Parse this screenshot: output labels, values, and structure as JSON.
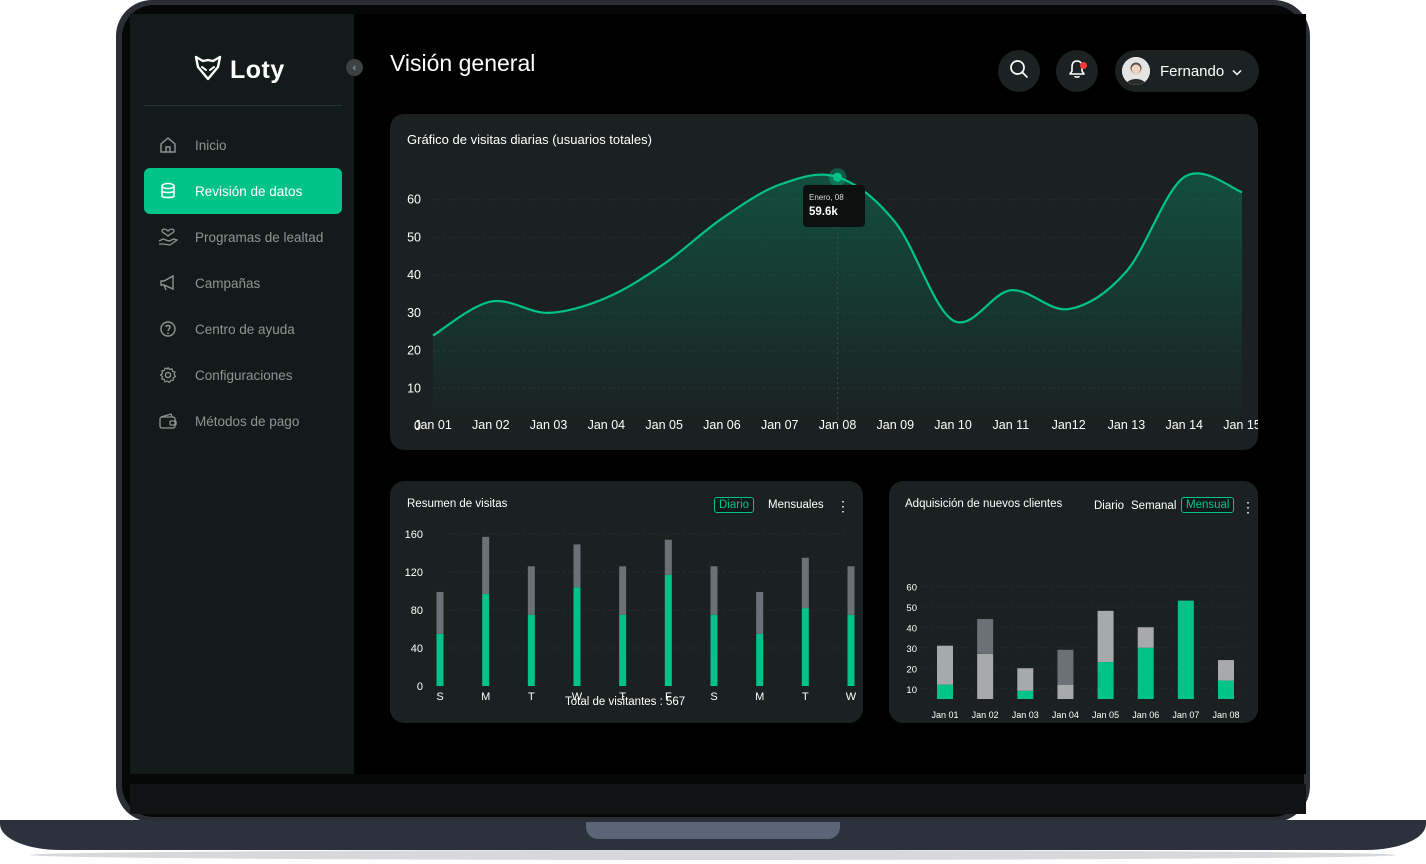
{
  "app": {
    "name": "Loty"
  },
  "sidebar": {
    "items": [
      {
        "label": "Inicio",
        "icon": "home-icon",
        "active": false
      },
      {
        "label": "Revisión de datos",
        "icon": "database-icon",
        "active": true
      },
      {
        "label": "Programas de lealtad",
        "icon": "hand-heart-icon",
        "active": false
      },
      {
        "label": "Campañas",
        "icon": "megaphone-icon",
        "active": false
      },
      {
        "label": "Centro de ayuda",
        "icon": "help-circle-icon",
        "active": false
      },
      {
        "label": "Configuraciones",
        "icon": "gear-icon",
        "active": false
      },
      {
        "label": "Métodos de pago",
        "icon": "wallet-icon",
        "active": false
      }
    ]
  },
  "header": {
    "title": "Visión general",
    "user": {
      "name": "Fernando"
    }
  },
  "colors": {
    "accent": "#00c389",
    "gray_bar": "#6b7176",
    "light_gray_bar": "#a7a9ab",
    "card": "#1a2120",
    "sidebar": "#131b1a"
  },
  "line_card": {
    "title": "Gráfico de visitas diarias (usuarios totales)",
    "tooltip": {
      "label": "Enero, 08",
      "value": "59.6k"
    }
  },
  "visits_card": {
    "title": "Resumen de visitas",
    "tabs": [
      "Diario",
      "Mensuales"
    ],
    "active_tab": "Diario",
    "total_label": "Total de visitantes : 567"
  },
  "acq_card": {
    "title": "Adquisición de nuevos clientes",
    "tabs": [
      "Diario",
      "Semanal",
      "Mensual"
    ],
    "active_tab": "Mensual"
  },
  "chart_data": [
    {
      "type": "area",
      "title": "Gráfico de visitas diarias (usuarios totales)",
      "categories": [
        "Jan 01",
        "Jan 02",
        "Jan 03",
        "Jan 04",
        "Jan 05",
        "Jan 06",
        "Jan 07",
        "Jan 08",
        "Jan 09",
        "Jan 10",
        "Jan 11",
        "Jan12",
        "Jan 13",
        "Jan 14",
        "Jan 15"
      ],
      "y_ticks": [
        0,
        10,
        20,
        30,
        40,
        50,
        60
      ],
      "ylim": [
        0,
        70
      ],
      "series": [
        {
          "x": [
            0,
            1,
            2,
            3,
            4,
            5,
            6,
            7,
            8,
            9,
            10,
            11,
            12,
            13,
            14
          ],
          "values": [
            24,
            33,
            30,
            34,
            43,
            55,
            64,
            66,
            54,
            28,
            36,
            31,
            41,
            66,
            62
          ]
        }
      ],
      "highlight": {
        "category": "Jan 08",
        "value": 66
      },
      "grid": true
    },
    {
      "type": "bar",
      "title": "Resumen de visitas",
      "stacked": true,
      "categories": [
        "S",
        "M",
        "T",
        "W",
        "T",
        "F",
        "S",
        "M",
        "T",
        "W"
      ],
      "y_ticks": [
        0,
        40,
        80,
        120,
        160
      ],
      "ylim": [
        0,
        160
      ],
      "series": [
        {
          "color": "#00c389",
          "values": [
            55,
            97,
            75,
            104,
            75,
            117,
            75,
            55,
            82,
            75
          ]
        },
        {
          "color": "#6b7176",
          "values": [
            44,
            60,
            51,
            45,
            51,
            37,
            51,
            44,
            53,
            51
          ]
        }
      ]
    },
    {
      "type": "bar",
      "title": "Adquisición de nuevos clientes",
      "stacked": true,
      "categories": [
        "Jan 01",
        "Jan 02",
        "Jan 03",
        "Jan 04",
        "Jan 05",
        "Jan 06",
        "Jan 07",
        "Jan 08"
      ],
      "y_ticks": [
        10,
        20,
        30,
        40,
        50,
        60
      ],
      "ylim": [
        5,
        65
      ],
      "series": [
        {
          "color": "#00c389",
          "values": [
            7,
            0,
            4,
            0,
            18,
            25,
            48,
            9
          ]
        },
        {
          "color": "#a7a9ab",
          "values": [
            19,
            22,
            11,
            7,
            25,
            10,
            0,
            10
          ]
        },
        {
          "color": "#6b7176",
          "values": [
            0,
            17,
            0,
            17,
            0,
            0,
            0,
            0
          ]
        }
      ]
    }
  ]
}
